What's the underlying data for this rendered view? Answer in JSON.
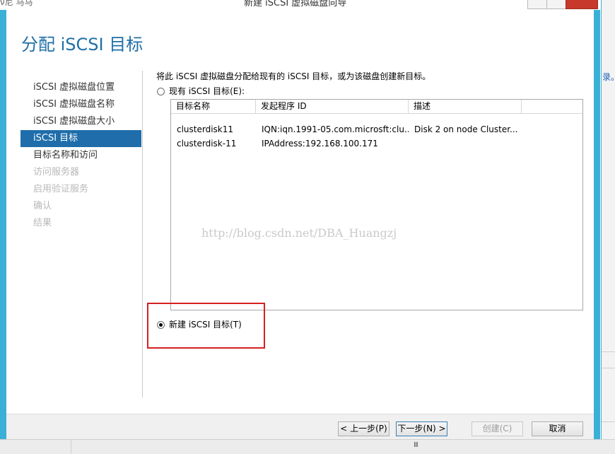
{
  "window": {
    "title": "新建 iSCSI 虚拟磁盘向导",
    "corner_text": "ν尼 马马"
  },
  "page_title": "分配 iSCSI 目标",
  "nav": {
    "items": [
      {
        "label": "iSCSI 虚拟磁盘位置",
        "state": "normal"
      },
      {
        "label": "iSCSI 虚拟磁盘名称",
        "state": "normal"
      },
      {
        "label": "iSCSI 虚拟磁盘大小",
        "state": "normal"
      },
      {
        "label": "iSCSI 目标",
        "state": "active"
      },
      {
        "label": "目标名称和访问",
        "state": "normal"
      },
      {
        "label": "访问服务器",
        "state": "disabled"
      },
      {
        "label": "启用验证服务",
        "state": "disabled"
      },
      {
        "label": "确认",
        "state": "disabled"
      },
      {
        "label": "结果",
        "state": "disabled"
      }
    ]
  },
  "main": {
    "instruction": "将此 iSCSI 虚拟磁盘分配给现有的 iSCSI 目标，或为该磁盘创建新目标。",
    "existing_target": {
      "label": "现有 iSCSI 目标(E):",
      "checked": false
    },
    "new_target": {
      "label": "新建 iSCSI 目标(T)",
      "checked": true
    },
    "table": {
      "columns": [
        "目标名称",
        "发起程序 ID",
        "描述",
        ""
      ],
      "rows": [
        [
          "clusterdisk11",
          "IQN:iqn.1991-05.com.microsft:clu...",
          "Disk 2 on node Cluster..."
        ],
        [
          "clusterdisk-11",
          "IPAddress:192.168.100.171",
          ""
        ]
      ]
    },
    "watermark": "http://blog.csdn.net/DBA_Huangzj"
  },
  "footer": {
    "prev": "< 上一步(P)",
    "next": "下一步(N) >",
    "create": "创建(C)",
    "cancel": "取消"
  },
  "background": {
    "right_edge_text": "录。",
    "bottom_grip": "III"
  },
  "colors": {
    "accent_blue": "#1f6eab",
    "frame_blue": "#3ab0d6",
    "title_blue": "#1e6fa8",
    "highlight_red": "#d42020"
  }
}
